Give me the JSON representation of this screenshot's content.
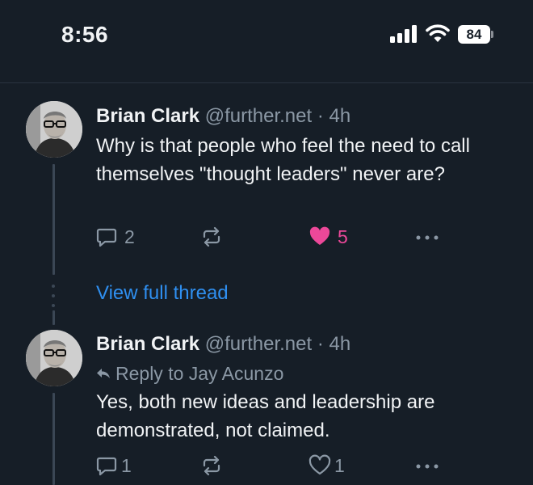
{
  "status_bar": {
    "time": "8:56",
    "battery": "84"
  },
  "view_full_thread": "View full thread",
  "posts": [
    {
      "author": "Brian Clark",
      "handle": "@further.net",
      "separator": "·",
      "age": "4h",
      "reply_to": null,
      "text": "Why is that people who feel the need to call themselves \"thought leaders\" never are?",
      "replies": "2",
      "reposts": "",
      "likes": "5",
      "liked": true
    },
    {
      "author": "Brian Clark",
      "handle": "@further.net",
      "separator": "·",
      "age": "4h",
      "reply_to": "Reply to Jay Acunzo",
      "text": "Yes, both new ideas and leadership are demonstrated, not claimed.",
      "replies": "1",
      "reposts": "",
      "likes": "1",
      "liked": false
    }
  ],
  "colors": {
    "background": "#161e27",
    "link": "#2f8ff0",
    "like_active": "#ec4899",
    "muted": "#8b98a5"
  }
}
